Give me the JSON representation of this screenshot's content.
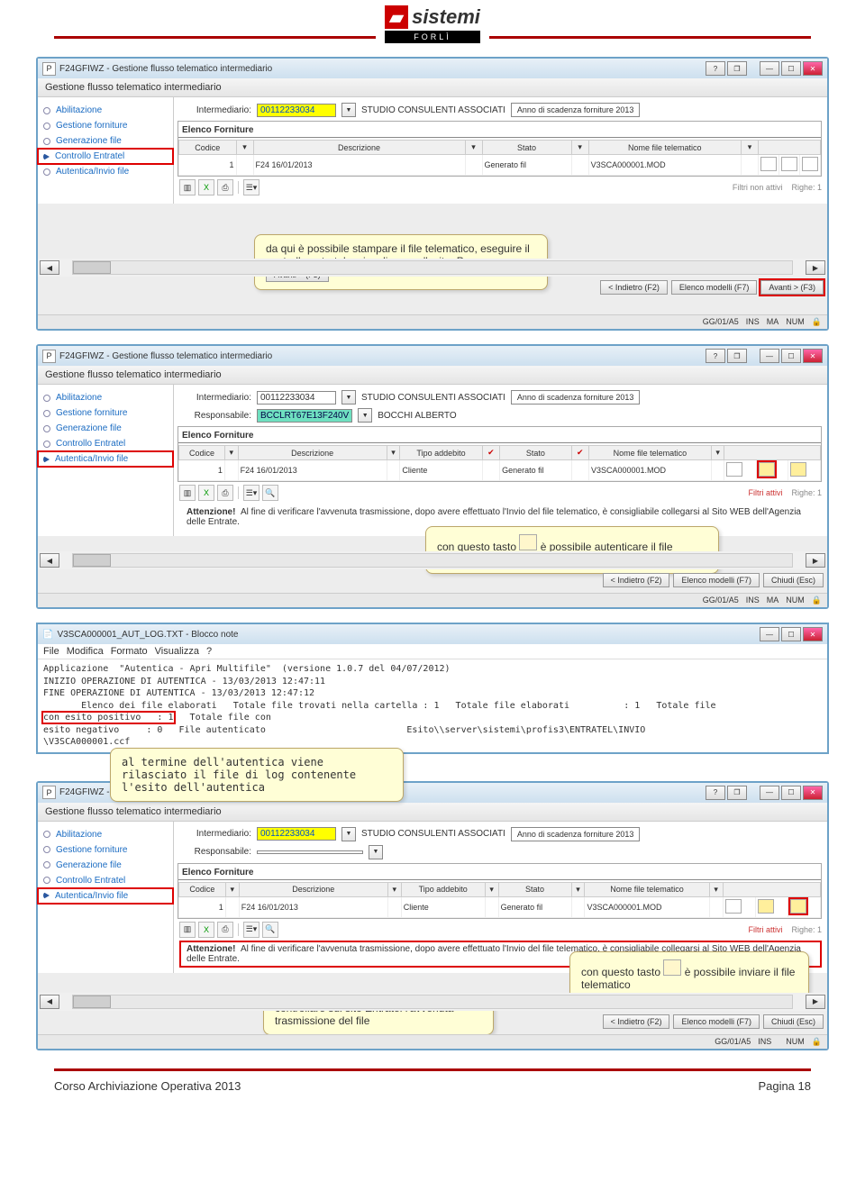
{
  "logo": {
    "brand": "sistemi",
    "sub": "FORLÌ"
  },
  "win1": {
    "title": "F24GFIWZ - Gestione flusso telematico intermediario",
    "subhead": "Gestione flusso telematico intermediario",
    "side": [
      "Abilitazione",
      "Gestione forniture",
      "Generazione file",
      "Controllo Entratel",
      "Autentica/Invio file"
    ],
    "int_lbl": "Intermediario:",
    "int_val": "00112233034",
    "int_name": "STUDIO CONSULENTI ASSOCIATI",
    "year": "Anno di scadenza forniture 2013",
    "sect": "Elenco Forniture",
    "cols": [
      "Codice",
      "Descrizione",
      "Stato",
      "Nome file telematico"
    ],
    "row": {
      "c": "1",
      "d": "F24 16/01/2013",
      "s": "Generato fil",
      "n": "V3SCA000001.MOD"
    },
    "filters": "Filtri non attivi",
    "rows": "Righe: 1",
    "b1": "< Indietro (F2)",
    "b2": "Elenco modelli (F7)",
    "b3": "Avanti > (F3)",
    "status": [
      "GG/01/A5",
      "INS",
      "MA",
      "NUM"
    ],
    "callout": "da qui è possibile stampare il file telematico, eseguire il controllo entratel e visualizzarne l'esito. Premere",
    "cbtn": "Avanti > (F3)"
  },
  "win2": {
    "title": "F24GFIWZ - Gestione flusso telematico intermediario",
    "subhead": "Gestione flusso telematico intermediario",
    "side": [
      "Abilitazione",
      "Gestione forniture",
      "Generazione file",
      "Controllo Entratel",
      "Autentica/Invio file"
    ],
    "int_lbl": "Intermediario:",
    "int_val": "00112233034",
    "int_name": "STUDIO CONSULENTI ASSOCIATI",
    "resp_lbl": "Responsabile:",
    "resp_val": "BCCLRT67E13F240V",
    "resp_name": "BOCCHI ALBERTO",
    "year": "Anno di scadenza forniture 2013",
    "sect": "Elenco Forniture",
    "cols": [
      "Codice",
      "Descrizione",
      "Tipo addebito",
      "Stato",
      "Nome file telematico"
    ],
    "row": {
      "c": "1",
      "d": "F24 16/01/2013",
      "t": "Cliente",
      "s": "Generato fil",
      "n": "V3SCA000001.MOD"
    },
    "filters": "Filtri attivi",
    "rows": "Righe: 1",
    "att_lbl": "Attenzione!",
    "att": "Al fine di verificare l'avvenuta trasmissione, dopo avere effettuato l'Invio del file telematico, è consigliabile collegarsi al Sito WEB dell'Agenzia delle Entrate.",
    "b1": "< Indietro (F2)",
    "b2": "Elenco modelli (F7)",
    "b3": "Chiudi (Esc)",
    "status": [
      "GG/01/A5",
      "INS",
      "MA",
      "NUM"
    ],
    "callout1": "con questo tasto",
    "callout2": "è possibile autenticare il file telematico"
  },
  "notepad": {
    "title": "V3SCA000001_AUT_LOG.TXT - Blocco note",
    "menu": [
      "File",
      "Modifica",
      "Formato",
      "Visualizza",
      "?"
    ],
    "l1": "Applicazione  \"Autentica - Apri Multifile\"  (versione 1.0.7 del 04/07/2012)",
    "l2": "INIZIO OPERAZIONE DI AUTENTICA - 13/03/2013 12:47:11",
    "l3": "FINE OPERAZIONE DI AUTENTICA - 13/03/2013 12:47:12",
    "l4": "       Elenco dei file elaborati   Totale file trovati nella cartella : 1   Totale file elaborati          : 1   Totale file",
    "l5a": "con esito positivo   : 1",
    "l5b": "   Totale file con",
    "l6": "esito negativo     : 0   File autenticato                          Esito\\\\server\\sistemi\\profis3\\ENTRATEL\\INVIO",
    "l7": "\\V3SCA000001.ccf",
    "callout": "al termine dell'autentica viene rilasciato il file di log contenente l'esito dell'autentica"
  },
  "win3": {
    "title": "F24GFIWZ - Gestione flusso telematico intermediario",
    "subhead": "Gestione flusso telematico intermediario",
    "side": [
      "Abilitazione",
      "Gestione forniture",
      "Generazione file",
      "Controllo Entratel",
      "Autentica/Invio file"
    ],
    "int_lbl": "Intermediario:",
    "int_val": "00112233034",
    "int_name": "STUDIO CONSULENTI ASSOCIATI",
    "resp_lbl": "Responsabile:",
    "resp_val": "",
    "year": "Anno di scadenza forniture 2013",
    "sect": "Elenco Forniture",
    "cols": [
      "Codice",
      "Descrizione",
      "Tipo addebito",
      "Stato",
      "Nome file telematico"
    ],
    "row": {
      "c": "1",
      "d": "F24 16/01/2013",
      "t": "Cliente",
      "s": "Generato fil",
      "n": "V3SCA000001.MOD"
    },
    "filters": "Filtri attivi",
    "rows": "Righe: 1",
    "att_lbl": "Attenzione!",
    "att": "Al fine di verificare l'avvenuta trasmissione, dopo avere effettuato l'Invio del file telematico, è consigliabile collegarsi al Sito WEB dell'Agenzia delle Entrate.",
    "b1": "< Indietro (F2)",
    "b2": "Elenco modelli (F7)",
    "b3": "Chiudi (Esc)",
    "status": [
      "GG/01/A5",
      "INS",
      "",
      "NUM"
    ],
    "callout_l": "controllare sul sito Entratel l'avvenuta trasmissione del file",
    "callout_r1": "con questo tasto",
    "callout_r2": "è possibile inviare il file telematico"
  },
  "footer": {
    "l": "Corso Archiviazione Operativa 2013",
    "r": "Pagina 18"
  }
}
